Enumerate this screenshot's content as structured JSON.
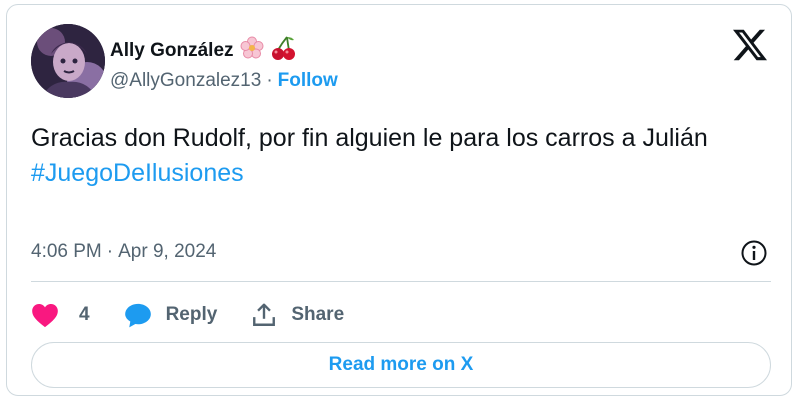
{
  "author": {
    "display_name": "Ally González",
    "handle": "@AllyGonzalez13",
    "separator": "·",
    "follow_label": "Follow",
    "emojis": [
      "flower-emoji",
      "cherries-emoji"
    ]
  },
  "tweet": {
    "text": "Gracias don Rudolf, por fin alguien le para los carros a Julián",
    "hashtag": "#JuegoDeIlusiones",
    "time": "4:06 PM",
    "meta_separator": "·",
    "date": "Apr 9, 2024"
  },
  "actions": {
    "like_count": "4",
    "reply_label": "Reply",
    "share_label": "Share"
  },
  "read_more_label": "Read more on X",
  "colors": {
    "accent": "#1d9bf0",
    "like": "#f91880",
    "text": "#0f1419",
    "muted": "#536471",
    "border": "#cfd9de"
  }
}
